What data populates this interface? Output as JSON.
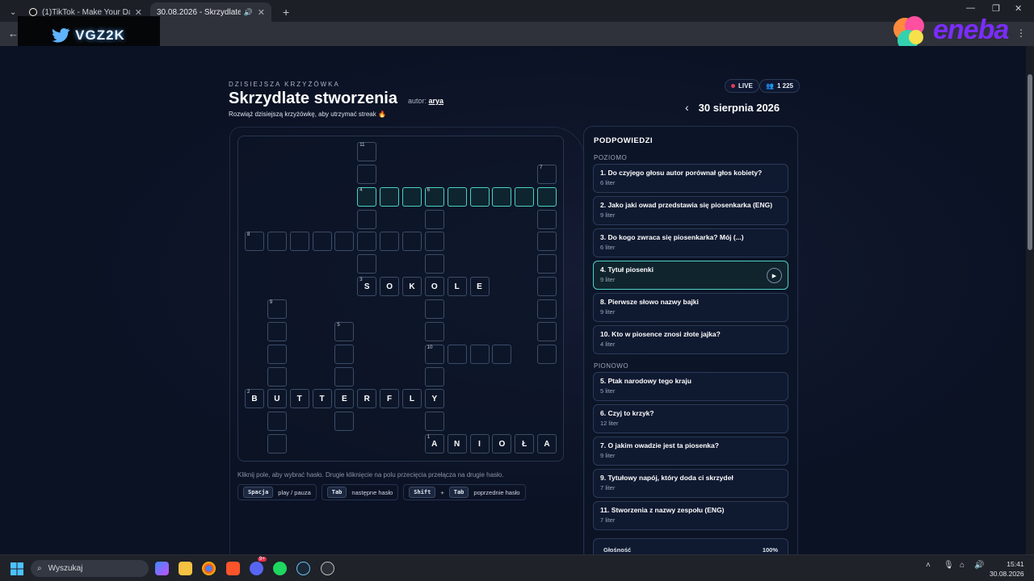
{
  "browser": {
    "tabs": [
      {
        "title": "(1)TikTok - Make Your Day",
        "active": false
      },
      {
        "title": "30.08.2026 - Skrzydlate stw",
        "active": true
      }
    ],
    "new_tab": "+",
    "window_controls": [
      "—",
      "❐",
      "✕"
    ]
  },
  "overlay": {
    "logo_text": "VGZ2K",
    "brand_text": "eneba"
  },
  "header": {
    "eyebrow": "DZISIEJSZA KRZYŻÓWKA",
    "title": "Skrzydlate stworzenia",
    "author_label": "autor:",
    "author_name": "arya",
    "subtitle": "Rozwiąż dzisiejszą krzyżówkę, aby utrzymać streak 🔥",
    "live": "LIVE",
    "viewers": "1 225",
    "date": "30 sierpnia 2026",
    "prev_arrow": "‹"
  },
  "grid": {
    "numbers": {
      "r0c5": "11",
      "r1c13": "7",
      "r2c5": "4",
      "r2c8": "6",
      "r4c0": "8",
      "r6c5": "3",
      "r7c1": "9",
      "r8c4": "5",
      "r9c8": "10",
      "r11c0": "2",
      "r13c8": "1"
    },
    "letters": {
      "r6c5": "S",
      "r6c6": "O",
      "r6c7": "K",
      "r6c8": "O",
      "r6c9": "L",
      "r6c10": "E",
      "r11c0": "B",
      "r11c1": "U",
      "r11c2": "T",
      "r11c3": "T",
      "r11c4": "E",
      "r11c5": "R",
      "r11c6": "F",
      "r11c7": "L",
      "r11c8": "Y",
      "r13c8": "A",
      "r13c9": "N",
      "r13c10": "I",
      "r13c11": "O",
      "r13c12": "Ł",
      "r13c13": "A"
    }
  },
  "help": {
    "hint": "Kliknij pole, aby wybrać hasło. Drugie kliknięcie na polu przecięcia przełącza na drugie hasło.",
    "shortcuts": [
      {
        "keys": [
          "Spacja"
        ],
        "label": "play / pauza"
      },
      {
        "keys": [
          "Tab"
        ],
        "label": "następne hasło"
      },
      {
        "keys": [
          "Shift",
          "Tab"
        ],
        "label": "poprzednie hasło",
        "joiner": "+"
      }
    ]
  },
  "clues": {
    "title": "PODPOWIEDZI",
    "across_label": "POZIOMO",
    "down_label": "PIONOWO",
    "across": [
      {
        "q": "1. Do czyjego głosu autor porównał głos kobiety?",
        "len": "6 liter"
      },
      {
        "q": "2. Jako jaki owad przedstawia się piosenkarka (ENG)",
        "len": "9 liter"
      },
      {
        "q": "3. Do kogo zwraca się piosenkarka? Mój (...)",
        "len": "6 liter"
      },
      {
        "q": "4. Tytuł piosenki",
        "len": "9 liter",
        "active": true,
        "play": "▶"
      },
      {
        "q": "8. Pierwsze słowo nazwy bajki",
        "len": "9 liter"
      },
      {
        "q": "10. Kto w piosence znosi złote jajka?",
        "len": "4 liter"
      }
    ],
    "down": [
      {
        "q": "5. Ptak narodowy tego kraju",
        "len": "5 liter"
      },
      {
        "q": "6. Czyj to krzyk?",
        "len": "12 liter"
      },
      {
        "q": "7. O jakim owadzie jest ta piosenka?",
        "len": "9 liter"
      },
      {
        "q": "9. Tytułowy napój, który doda ci skrzydeł",
        "len": "7 liter"
      },
      {
        "q": "11. Stworzenia z nazwy zespołu (ENG)",
        "len": "7 liter"
      }
    ],
    "volume_label": "Głośność",
    "volume_value": "100%"
  },
  "taskbar": {
    "search_placeholder": "Wyszukaj",
    "discord_badge": "9+",
    "time": "15:41",
    "date": "30.08.2026"
  }
}
